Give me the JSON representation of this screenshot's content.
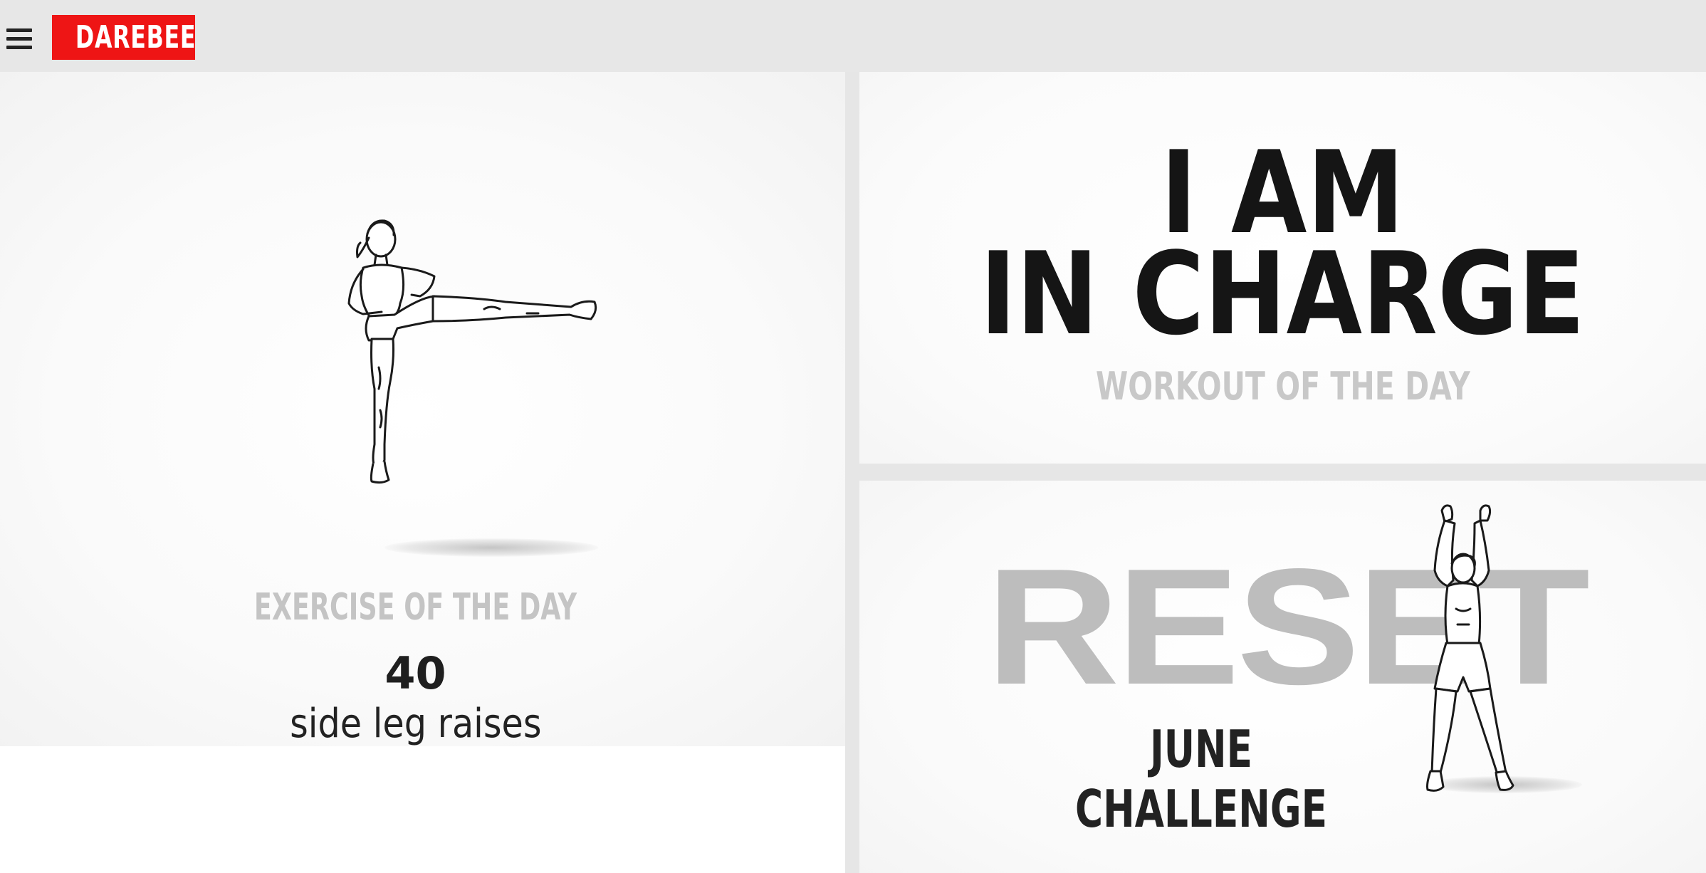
{
  "header": {
    "menu_icon": "hamburger-menu-icon",
    "logo_text": "DAREBEE",
    "logo_color": "#ee1515"
  },
  "exercise_of_the_day": {
    "label": "EXERCISE OF THE DAY",
    "count": "40",
    "name": "side leg raises"
  },
  "workout_of_the_day": {
    "title_line1": "I AM",
    "title_line2": "IN CHARGE",
    "label": "WORKOUT OF THE DAY"
  },
  "challenge": {
    "word": "RESET",
    "label": "JUNE CHALLENGE"
  }
}
